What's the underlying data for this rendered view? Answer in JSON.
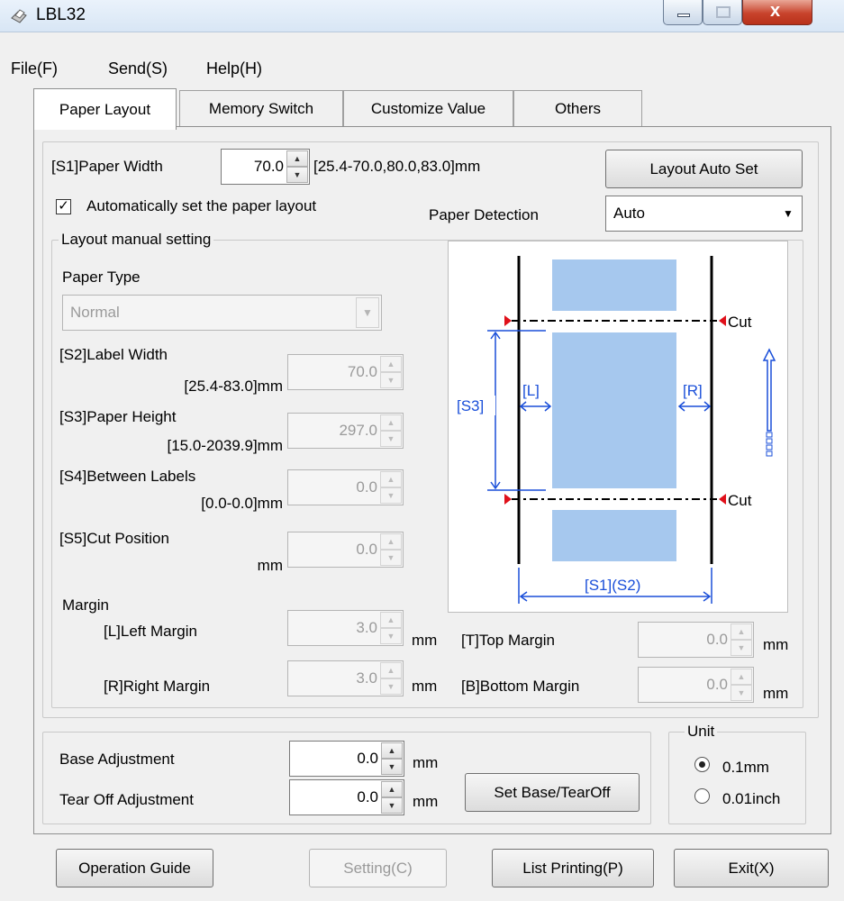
{
  "window": {
    "title": "LBL32"
  },
  "menu": {
    "file": "File(F)",
    "send": "Send(S)",
    "help": "Help(H)"
  },
  "tabs": [
    "Paper Layout",
    "Memory Switch",
    "Customize Value",
    "Others"
  ],
  "paper_width": {
    "label": "[S1]Paper Width",
    "value": "70.0",
    "range": "[25.4-70.0,80.0,83.0]mm"
  },
  "layout_auto_set": "Layout Auto Set",
  "auto_layout": {
    "label": "Automatically set the paper layout",
    "checked": true
  },
  "paper_detection": {
    "label": "Paper Detection",
    "value": "Auto"
  },
  "manual": {
    "legend": "Layout manual setting",
    "paper_type": {
      "label": "Paper Type",
      "value": "Normal"
    },
    "label_width": {
      "label": "[S2]Label Width",
      "range": "[25.4-83.0]mm",
      "value": "70.0"
    },
    "paper_height": {
      "label": "[S3]Paper Height",
      "range": "[15.0-2039.9]mm",
      "value": "297.0"
    },
    "between_labels": {
      "label": "[S4]Between Labels",
      "range": "[0.0-0.0]mm",
      "value": "0.0"
    },
    "cut_position": {
      "label": "[S5]Cut Position",
      "range": "mm",
      "value": "0.0"
    },
    "margin": {
      "title": "Margin",
      "left": {
        "label": "[L]Left Margin",
        "value": "3.0",
        "unit": "mm"
      },
      "right": {
        "label": "[R]Right Margin",
        "value": "3.0",
        "unit": "mm"
      },
      "top": {
        "label": "[T]Top Margin",
        "value": "0.0",
        "unit": "mm"
      },
      "bottom": {
        "label": "[B]Bottom Margin",
        "value": "0.0",
        "unit": "mm"
      }
    }
  },
  "diagram": {
    "cut_top": "Cut",
    "cut_bottom": "Cut",
    "s3": "[S3]",
    "l": "[L]",
    "r": "[R]",
    "s1s2": "[S1](S2)"
  },
  "adjust": {
    "base": {
      "label": "Base Adjustment",
      "value": "0.0",
      "unit": "mm"
    },
    "tear": {
      "label": "Tear Off Adjustment",
      "value": "0.0",
      "unit": "mm"
    },
    "set_button": "Set Base/TearOff"
  },
  "unit": {
    "legend": "Unit",
    "opt1": "0.1mm",
    "opt2": "0.01inch",
    "selected": "0.1mm"
  },
  "buttons": {
    "guide": "Operation Guide",
    "setting": "Setting(C)",
    "list": "List Printing(P)",
    "exit": "Exit(X)"
  },
  "colors": {
    "label_fill": "#a6c8ee",
    "dimension_blue": "#1a4fd9",
    "cut_red": "#e0101a",
    "title_bar": "#dce8f5"
  }
}
